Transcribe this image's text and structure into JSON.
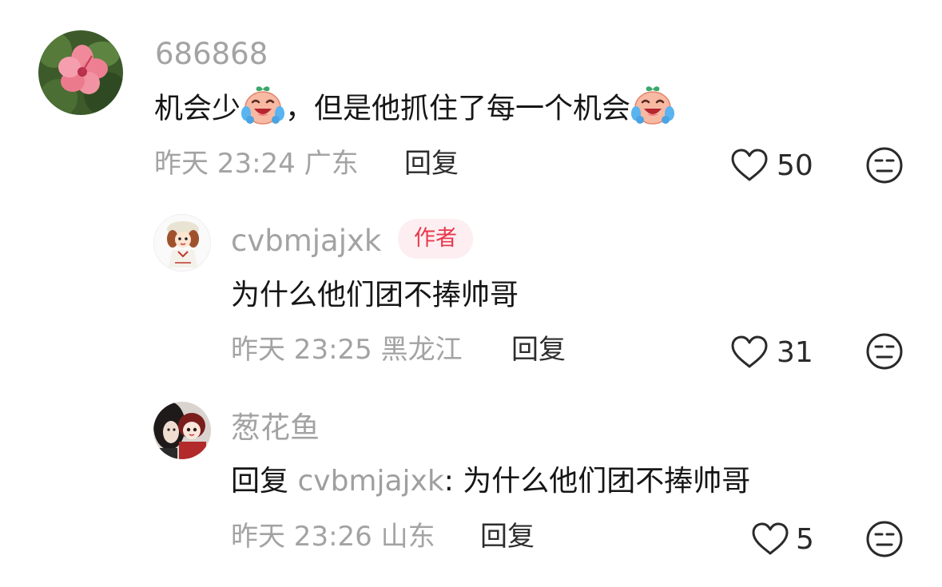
{
  "comments": [
    {
      "username": "686868",
      "text_part1": "机会少",
      "text_part2": "，但是他抓住了每一个机会",
      "emoji_icon": "crying-laughing-baby-icon",
      "meta": "昨天 23:24 广东",
      "reply_label": "回复",
      "likes": "50",
      "avatar_icon": "hibiscus-flower-avatar"
    },
    {
      "username": "cvbmjajxk",
      "badge": "作者",
      "text": "为什么他们团不捧帅哥",
      "meta": "昨天 23:25 黑龙江",
      "reply_label": "回复",
      "likes": "31",
      "avatar_icon": "chibi-character-avatar"
    },
    {
      "username": "葱花鱼",
      "reply_prefix": "回复",
      "reply_target": "cvbmjajxk",
      "reply_text": ": 为什么他们团不捧帅哥",
      "meta": "昨天 23:26 山东",
      "reply_label": "回复",
      "likes": "5",
      "avatar_icon": "doll-photo-avatar"
    }
  ],
  "colors": {
    "username": "#a3a3a3",
    "text": "#161616",
    "badge_text": "#e8384d",
    "badge_bg": "#fdeff1"
  }
}
